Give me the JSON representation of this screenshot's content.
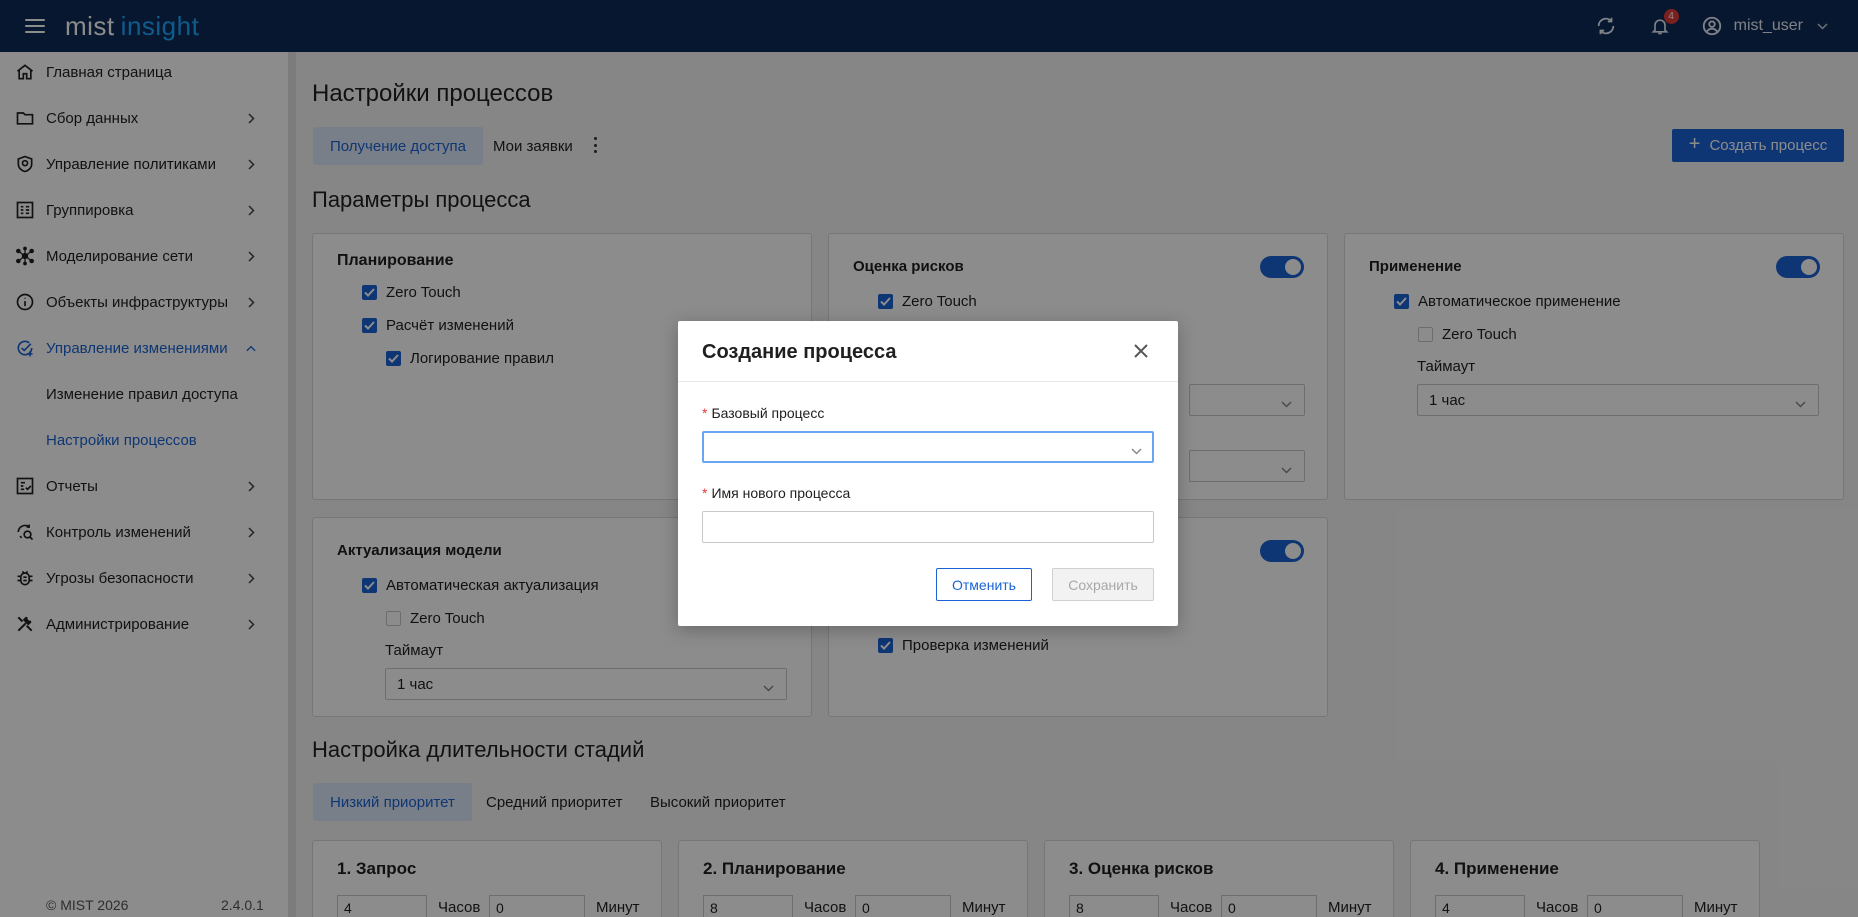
{
  "header": {
    "logo_part1": "mist",
    "logo_part2": "insight",
    "notification_count": "4",
    "username": "mist_user"
  },
  "sidebar": {
    "items": [
      {
        "label": "Главная страница",
        "icon": "home-icon"
      },
      {
        "label": "Сбор данных",
        "icon": "folder-icon"
      },
      {
        "label": "Управление политиками",
        "icon": "shield-icon"
      },
      {
        "label": "Группировка",
        "icon": "grouping-icon"
      },
      {
        "label": "Моделирование сети",
        "icon": "network-icon"
      },
      {
        "label": "Объекты инфраструктуры",
        "icon": "info-icon"
      },
      {
        "label": "Управление изменениями",
        "icon": "change-management-icon"
      },
      {
        "label": "Отчеты",
        "icon": "report-icon"
      },
      {
        "label": "Контроль изменений",
        "icon": "change-control-icon"
      },
      {
        "label": "Угрозы безопасности",
        "icon": "bug-icon"
      },
      {
        "label": "Администрирование",
        "icon": "tools-icon"
      }
    ],
    "subitems": [
      {
        "label": "Изменение правил доступа"
      },
      {
        "label": "Настройки процессов"
      }
    ],
    "footer": "© MIST 2026",
    "version": "2.4.0.1"
  },
  "main": {
    "title": "Настройки процессов",
    "tabs": [
      {
        "label": "Получение доступа"
      },
      {
        "label": "Мои заявки"
      }
    ],
    "create_button": "Создать процесс",
    "params_title": "Параметры процесса",
    "cards": {
      "planning": {
        "title": "Планирование",
        "checks": [
          "Zero Touch",
          "Расчёт изменений",
          "Логирование правил"
        ]
      },
      "risk": {
        "title": "Оценка рисков",
        "checks": [
          "Zero Touch"
        ]
      },
      "apply": {
        "title": "Применение",
        "checks": [
          "Автоматическое применение",
          "Zero Touch"
        ],
        "timeout_label": "Таймаут",
        "timeout_value": "1 час"
      },
      "model": {
        "title": "Актуализация модели",
        "checks": [
          "Автоматическая актуализация",
          "Zero Touch"
        ],
        "timeout_label": "Таймаут",
        "timeout_value": "1 час"
      },
      "verify": {
        "checks": [
          "Проверка изменений"
        ]
      }
    },
    "stages_title": "Настройка длительности стадий",
    "priority_tabs": [
      {
        "label": "Низкий приоритет"
      },
      {
        "label": "Средний приоритет"
      },
      {
        "label": "Высокий приоритет"
      }
    ],
    "stages": [
      {
        "title": "1. Запрос",
        "hours": "4",
        "minutes": "0"
      },
      {
        "title": "2. Планирование",
        "hours": "8",
        "minutes": "0"
      },
      {
        "title": "3. Оценка рисков",
        "hours": "8",
        "minutes": "0"
      },
      {
        "title": "4. Применение",
        "hours": "4",
        "minutes": "0"
      }
    ],
    "hours_label": "Часов",
    "minutes_label": "Минут"
  },
  "modal": {
    "title": "Создание процесса",
    "base_process_label": "Базовый процесс",
    "new_name_label": "Имя нового процесса",
    "new_name_value": "",
    "cancel_label": "Отменить",
    "save_label": "Сохранить"
  },
  "colors": {
    "header_bg": "#0e2a57",
    "accent": "#1a63d4",
    "logo_accent": "#1ea6ff",
    "badge": "#e23a3a"
  }
}
